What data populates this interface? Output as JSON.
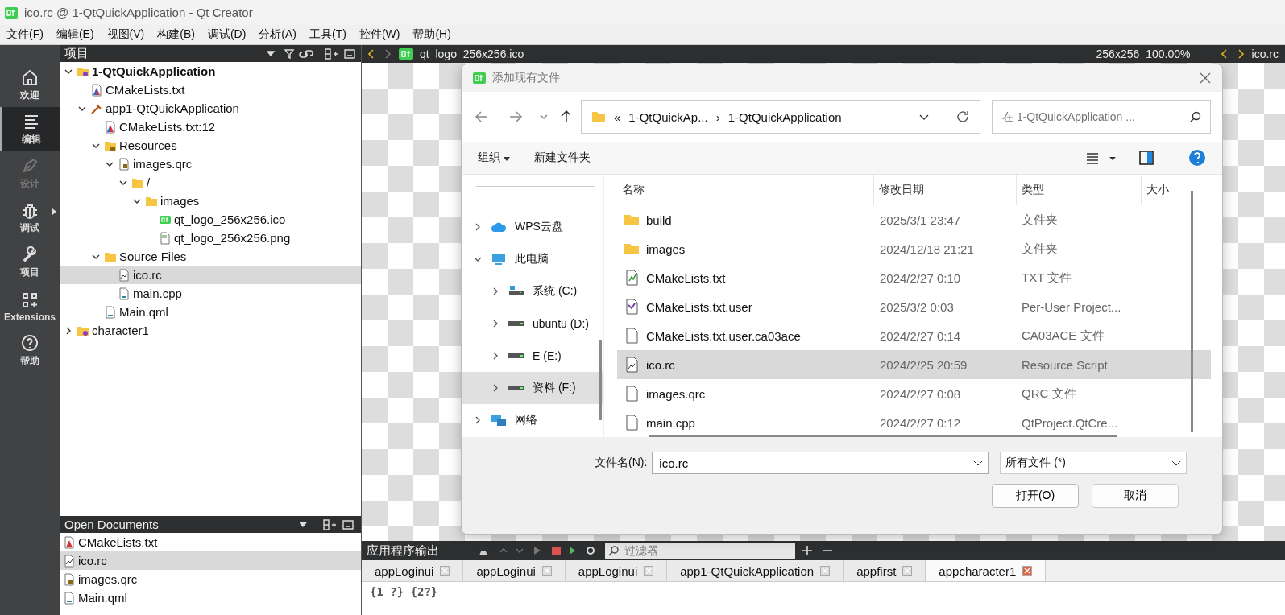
{
  "window": {
    "title": "ico.rc @ 1-QtQuickApplication - Qt Creator"
  },
  "menu": [
    "文件(F)",
    "编辑(E)",
    "视图(V)",
    "构建(B)",
    "调试(D)",
    "分析(A)",
    "工具(T)",
    "控件(W)",
    "帮助(H)"
  ],
  "modes": [
    {
      "label": "欢迎",
      "selected": false,
      "disabled": false
    },
    {
      "label": "编辑",
      "selected": true,
      "disabled": false
    },
    {
      "label": "设计",
      "selected": false,
      "disabled": true
    },
    {
      "label": "调试",
      "selected": false,
      "disabled": false
    },
    {
      "label": "项目",
      "selected": false,
      "disabled": false
    },
    {
      "label": "Extensions",
      "selected": false,
      "disabled": false
    },
    {
      "label": "帮助",
      "selected": false,
      "disabled": false
    }
  ],
  "project_panel": {
    "title": "项目",
    "tree": [
      {
        "label": "1-QtQuickApplication",
        "kind": "project",
        "expanded": true,
        "selected": false,
        "children": [
          {
            "label": "CMakeLists.txt",
            "kind": "cmake",
            "selected": false
          },
          {
            "label": "app1-QtQuickApplication",
            "kind": "target",
            "expanded": true,
            "selected": false,
            "children": [
              {
                "label": "CMakeLists.txt:12",
                "kind": "cmake",
                "selected": false
              },
              {
                "label": "Resources",
                "kind": "resfolder",
                "expanded": true,
                "selected": false,
                "children": [
                  {
                    "label": "images.qrc",
                    "kind": "qrc",
                    "expanded": true,
                    "selected": false,
                    "children": [
                      {
                        "label": "/",
                        "kind": "folder",
                        "expanded": true,
                        "selected": false,
                        "children": [
                          {
                            "label": "images",
                            "kind": "folder",
                            "expanded": true,
                            "selected": false,
                            "children": [
                              {
                                "label": "qt_logo_256x256.ico",
                                "kind": "ico",
                                "selected": false
                              },
                              {
                                "label": "qt_logo_256x256.png",
                                "kind": "png",
                                "selected": false
                              }
                            ]
                          }
                        ]
                      }
                    ]
                  }
                ]
              },
              {
                "label": "Source Files",
                "kind": "srcfolder",
                "expanded": true,
                "selected": false,
                "children": [
                  {
                    "label": "ico.rc",
                    "kind": "rc",
                    "selected": true
                  },
                  {
                    "label": "main.cpp",
                    "kind": "cpp",
                    "selected": false
                  }
                ]
              },
              {
                "label": "Main.qml",
                "kind": "qml",
                "selected": false
              }
            ]
          }
        ]
      },
      {
        "label": "character1",
        "kind": "project",
        "expanded": false,
        "selected": false
      }
    ]
  },
  "open_documents": {
    "title": "Open Documents",
    "items": [
      {
        "label": "CMakeLists.txt",
        "kind": "cmake",
        "selected": false
      },
      {
        "label": "ico.rc",
        "kind": "rc",
        "selected": true
      },
      {
        "label": "images.qrc",
        "kind": "qrc",
        "selected": false
      },
      {
        "label": "Main.qml",
        "kind": "qml",
        "selected": false
      }
    ]
  },
  "editor_toolbar": {
    "file": "qt_logo_256x256.ico",
    "size": "256x256",
    "zoom": "100.00%",
    "document": "ico.rc"
  },
  "output": {
    "title": "应用程序输出",
    "filter_placeholder": "过滤器",
    "tabs": [
      {
        "label": "appLoginui",
        "selected": false
      },
      {
        "label": "appLoginui",
        "selected": false
      },
      {
        "label": "appLoginui",
        "selected": false
      },
      {
        "label": "app1-QtQuickApplication",
        "selected": false
      },
      {
        "label": "appfirst",
        "selected": false
      },
      {
        "label": "appcharacter1",
        "selected": true
      }
    ],
    "text": "{1 ?} {2?}"
  },
  "dialog": {
    "title": "添加现有文件",
    "path": {
      "overflow": "«",
      "parent": "1-QtQuickAp...",
      "separator": "›",
      "current": "1-QtQuickApplication"
    },
    "search_placeholder": "在 1-QtQuickApplication ...",
    "toolbar": {
      "organize": "组织",
      "new_folder": "新建文件夹"
    },
    "nav": [
      {
        "label": "WPS云盘",
        "kind": "cloud",
        "expanded": false,
        "selected": false
      },
      {
        "label": "此电脑",
        "kind": "pc",
        "expanded": true,
        "selected": false,
        "children": [
          {
            "label": "系统 (C:)",
            "kind": "system",
            "expanded": false,
            "selected": false
          },
          {
            "label": "ubuntu (D:)",
            "kind": "drive",
            "expanded": false,
            "selected": false
          },
          {
            "label": "E (E:)",
            "kind": "drive",
            "expanded": false,
            "selected": false
          },
          {
            "label": "资料 (F:)",
            "kind": "drive",
            "expanded": false,
            "selected": true
          }
        ]
      },
      {
        "label": "网络",
        "kind": "network",
        "expanded": false,
        "selected": false
      }
    ],
    "columns": [
      "名称",
      "修改日期",
      "类型",
      "大小"
    ],
    "files": [
      {
        "name": "build",
        "kind": "folder",
        "date": "2025/3/1 23:47",
        "type": "文件夹",
        "selected": false
      },
      {
        "name": "images",
        "kind": "folder",
        "date": "2024/12/18 21:21",
        "type": "文件夹",
        "selected": false
      },
      {
        "name": "CMakeLists.txt",
        "kind": "txt",
        "date": "2024/2/27 0:10",
        "type": "TXT 文件",
        "selected": false
      },
      {
        "name": "CMakeLists.txt.user",
        "kind": "user",
        "date": "2025/3/2 0:03",
        "type": "Per-User Project...",
        "selected": false
      },
      {
        "name": "CMakeLists.txt.user.ca03ace",
        "kind": "file",
        "date": "2024/2/27 0:14",
        "type": "CA03ACE 文件",
        "selected": false
      },
      {
        "name": "ico.rc",
        "kind": "image",
        "date": "2024/2/25 20:59",
        "type": "Resource Script",
        "selected": true
      },
      {
        "name": "images.qrc",
        "kind": "file",
        "date": "2024/2/27 0:08",
        "type": "QRC 文件",
        "selected": false
      },
      {
        "name": "main.cpp",
        "kind": "file",
        "date": "2024/2/27 0:12",
        "type": "QtProject.QtCre...",
        "selected": false
      }
    ],
    "filename_label": "文件名(N):",
    "filename": "ico.rc",
    "filter": "所有文件 (*)",
    "open_button": "打开(O)",
    "cancel_button": "取消"
  }
}
